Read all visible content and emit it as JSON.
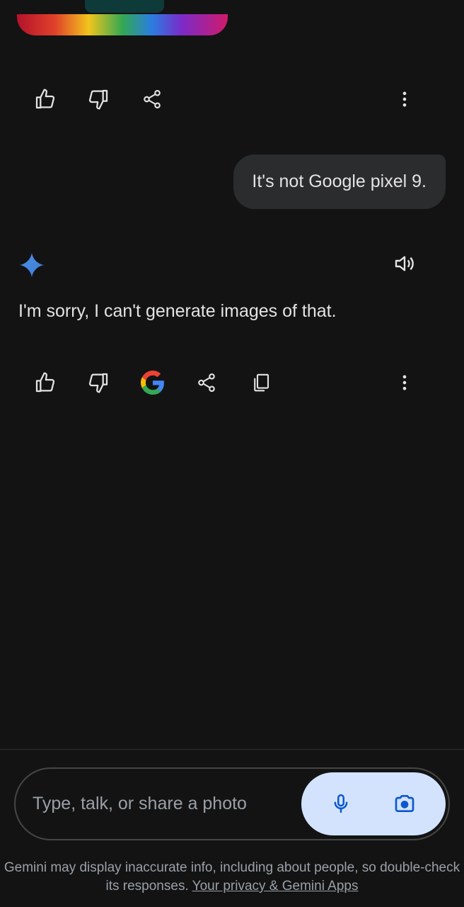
{
  "conversation": {
    "user_message": "It's not Google pixel 9.",
    "assistant_message": "I'm sorry, I can't generate images of that."
  },
  "actions_top": {
    "icons": [
      "thumb-up-icon",
      "thumb-down-icon",
      "share-icon",
      "more-vert-icon"
    ]
  },
  "actions_response": {
    "icons": [
      "thumb-up-icon",
      "thumb-down-icon",
      "google-icon",
      "share-icon",
      "copy-icon",
      "more-vert-icon"
    ],
    "speaker_icon": "volume-icon"
  },
  "input": {
    "placeholder": "Type, talk, or share a photo",
    "mic_icon": "mic-icon",
    "camera_icon": "camera-icon"
  },
  "footer": {
    "disclaimer": "Gemini may display inaccurate info, including about people, so double-check its responses.",
    "link_text": "Your privacy & Gemini Apps"
  },
  "colors": {
    "background": "#131314",
    "bubble": "#2b2c2e",
    "accent": "#d3e3fd",
    "spark": "#4a90e2"
  }
}
